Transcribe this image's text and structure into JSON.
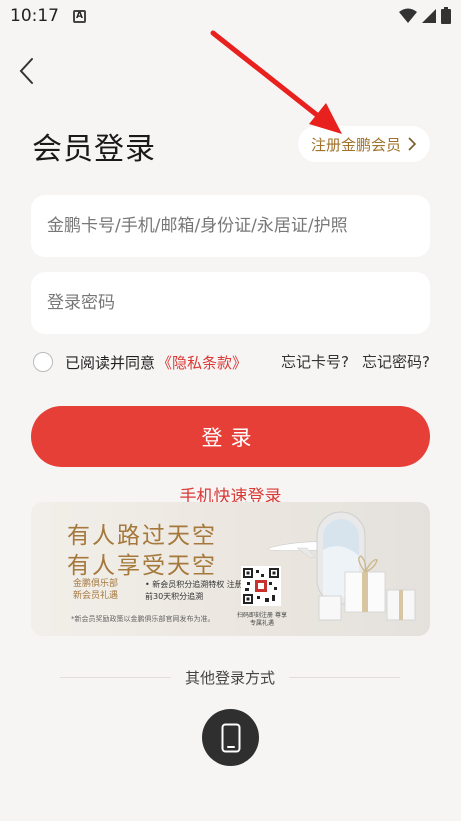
{
  "status_bar": {
    "time": "10:17",
    "notification_icon": "A"
  },
  "header": {
    "back_icon": "chevron-left-icon",
    "title": "会员登录",
    "register_label": "注册金鹏会员"
  },
  "form": {
    "account_placeholder": "金鹏卡号/手机/邮箱/身份证/永居证/护照",
    "password_placeholder": "登录密码",
    "agree_text": "已阅读并同意",
    "privacy_link": "《隐私条款》",
    "forgot_card": "忘记卡号?",
    "forgot_password": "忘记密码?",
    "login_label": "登录",
    "quick_login_label": "手机快速登录"
  },
  "banner": {
    "line1": "有人路过天空",
    "line2": "有人享受天空",
    "club": "金鹏俱乐部 新会员礼遇",
    "benefit": "• 新会员积分追溯特权 注册前30天积分追溯",
    "fine_print": "*新会员奖励政策以金鹏俱乐部官网发布为准。",
    "qr_caption": "扫码即刻注册 尊享专属礼遇"
  },
  "other_login": {
    "title": "其他登录方式",
    "phone_icon": "mobile-phone-icon"
  },
  "colors": {
    "accent": "#e63f37",
    "gold": "#a0722b",
    "background": "#f7f4f4"
  }
}
